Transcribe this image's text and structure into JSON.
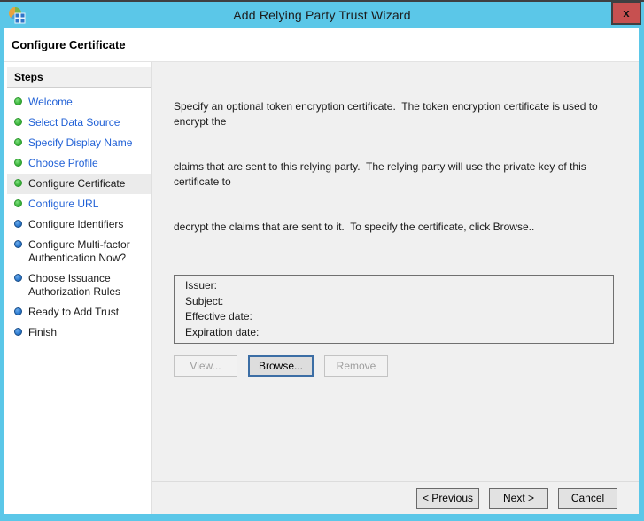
{
  "window": {
    "title": "Add Relying Party Trust Wizard",
    "close_glyph": "x"
  },
  "header": {
    "title": "Configure Certificate"
  },
  "sidebar": {
    "title": "Steps",
    "items": [
      {
        "label": "Welcome",
        "state": "completed"
      },
      {
        "label": "Select Data Source",
        "state": "completed"
      },
      {
        "label": "Specify Display Name",
        "state": "completed"
      },
      {
        "label": "Choose Profile",
        "state": "completed"
      },
      {
        "label": "Configure Certificate",
        "state": "current"
      },
      {
        "label": "Configure URL",
        "state": "completed"
      },
      {
        "label": "Configure Identifiers",
        "state": "pending"
      },
      {
        "label": "Configure Multi-factor Authentication Now?",
        "state": "pending"
      },
      {
        "label": "Choose Issuance Authorization Rules",
        "state": "pending"
      },
      {
        "label": "Ready to Add Trust",
        "state": "pending"
      },
      {
        "label": "Finish",
        "state": "pending"
      }
    ]
  },
  "content": {
    "description_lines": [
      "Specify an optional token encryption certificate.  The token encryption certificate is used to encrypt the",
      "claims that are sent to this relying party.  The relying party will use the private key of this certificate to",
      "decrypt the claims that are sent to it.  To specify the certificate, click Browse.."
    ],
    "certificate": {
      "fields": [
        {
          "label": "Issuer:",
          "value": ""
        },
        {
          "label": "Subject:",
          "value": ""
        },
        {
          "label": "Effective date:",
          "value": ""
        },
        {
          "label": "Expiration date:",
          "value": ""
        }
      ]
    },
    "buttons": {
      "view": {
        "label": "View...",
        "enabled": false
      },
      "browse": {
        "label": "Browse...",
        "enabled": true,
        "focused": true
      },
      "remove": {
        "label": "Remove",
        "enabled": false
      }
    }
  },
  "footer": {
    "previous_label": "< Previous",
    "next_label": "Next >",
    "cancel_label": "Cancel"
  },
  "colors": {
    "frame": "#5bc7e8",
    "close_button": "#c75050",
    "content_background": "#f0f0f0",
    "link": "#2161d6",
    "completed_bullet": "#3db53d",
    "pending_bullet": "#2b7ad0",
    "focus_border": "#3c6ea5"
  }
}
